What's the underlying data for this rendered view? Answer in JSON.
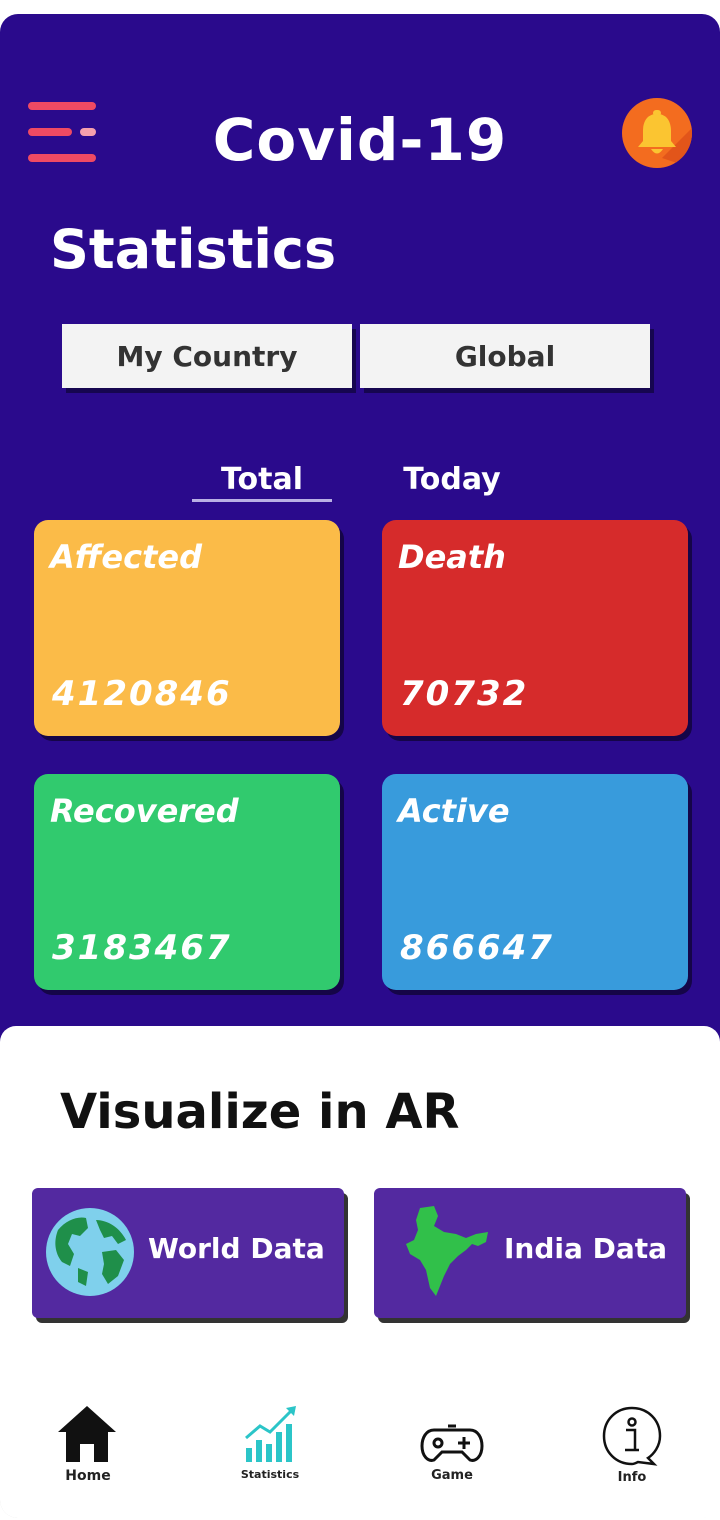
{
  "header": {
    "app_title": "Covid-19",
    "menu_icon": "hamburger-menu-icon",
    "bell_icon": "notification-bell-icon"
  },
  "statistics": {
    "title": "Statistics",
    "segments": [
      "My Country",
      "Global"
    ],
    "tabs": [
      "Total",
      "Today"
    ],
    "active_tab": "Total",
    "cards": [
      {
        "label": "Affected",
        "value": "4120846",
        "color": "#fbbb48"
      },
      {
        "label": "Death",
        "value": "70732",
        "color": "#d62b2b"
      },
      {
        "label": "Recovered",
        "value": "3183467",
        "color": "#31ca6e"
      },
      {
        "label": "Active",
        "value": "866647",
        "color": "#389bdc"
      }
    ]
  },
  "ar": {
    "title": "Visualize in AR",
    "buttons": [
      {
        "label": "World Data",
        "icon": "globe-icon"
      },
      {
        "label": "India Data",
        "icon": "india-map-icon"
      }
    ]
  },
  "bottom_nav": [
    {
      "label": "Home",
      "icon": "home-icon"
    },
    {
      "label": "Statistics",
      "icon": "statistics-chart-icon"
    },
    {
      "label": "Game",
      "icon": "gamepad-icon"
    },
    {
      "label": "Info",
      "icon": "info-icon"
    }
  ],
  "colors": {
    "header_bg": "#2a0a8c",
    "accent_red": "#ef4a63",
    "ar_button_bg": "#5329a0"
  }
}
